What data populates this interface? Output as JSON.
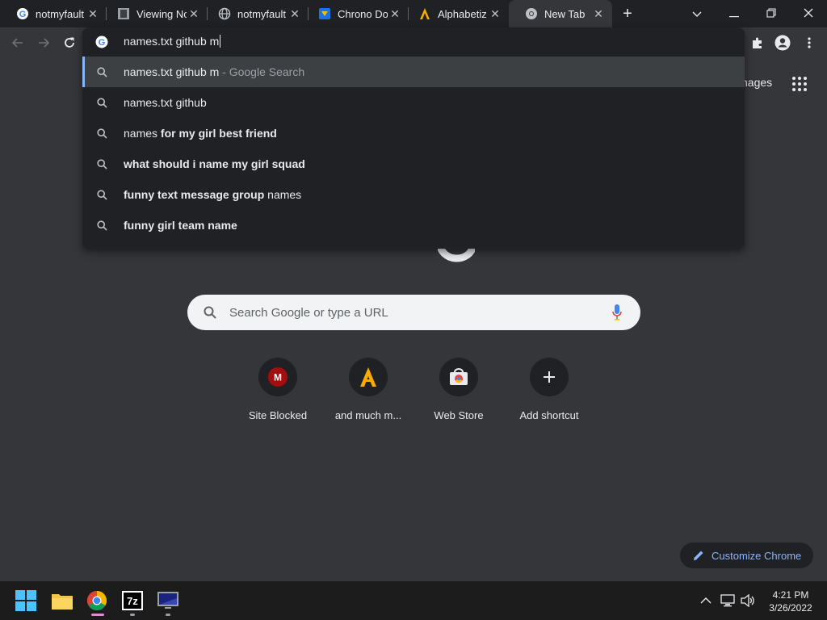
{
  "tabs": [
    {
      "title": "notmyfault",
      "icon": "google-g-icon"
    },
    {
      "title": "Viewing No",
      "icon": "viewing-page-icon"
    },
    {
      "title": "notmyfault",
      "icon": "globe-icon"
    },
    {
      "title": "Chrono Do",
      "icon": "chrono-download-icon"
    },
    {
      "title": "Alphabetiz",
      "icon": "alphabetizer-a-icon"
    },
    {
      "title": "New Tab",
      "icon": "chrome-icon"
    }
  ],
  "omnibox": {
    "input_value": "names.txt github m",
    "suggestions": [
      {
        "parts": [
          {
            "t": "names.txt github m",
            "s": "normal"
          },
          {
            "t": " - Google Search",
            "s": "dim"
          }
        ]
      },
      {
        "parts": [
          {
            "t": "names.txt github",
            "s": "normal"
          }
        ]
      },
      {
        "parts": [
          {
            "t": "names ",
            "s": "normal"
          },
          {
            "t": "for my girl best friend",
            "s": "bold"
          }
        ]
      },
      {
        "parts": [
          {
            "t": "what should i name my girl squad",
            "s": "bold"
          }
        ]
      },
      {
        "parts": [
          {
            "t": "funny text message group ",
            "s": "bold"
          },
          {
            "t": "names",
            "s": "normal"
          }
        ]
      },
      {
        "parts": [
          {
            "t": "funny girl team name",
            "s": "bold"
          }
        ]
      }
    ]
  },
  "ntp": {
    "images_link": "nages",
    "search_placeholder": "Search Google or type a URL",
    "shortcuts": [
      {
        "label": "Site Blocked",
        "icon": "site-blocked-m-icon"
      },
      {
        "label": "and much m...",
        "icon": "and-much-more-a-icon"
      },
      {
        "label": "Web Store",
        "icon": "web-store-icon"
      },
      {
        "label": "Add shortcut",
        "icon": "plus-icon"
      }
    ],
    "customize_label": "Customize Chrome"
  },
  "taskbar": {
    "apps": [
      "windows-start-icon",
      "file-explorer-icon",
      "chrome-icon",
      "7zip-icon",
      "monitor-app-icon"
    ],
    "time": "4:21 PM",
    "date": "3/26/2022"
  },
  "colors": {
    "accent": "#8ab4f8",
    "background": "#35363a",
    "dropdown": "#202124"
  }
}
